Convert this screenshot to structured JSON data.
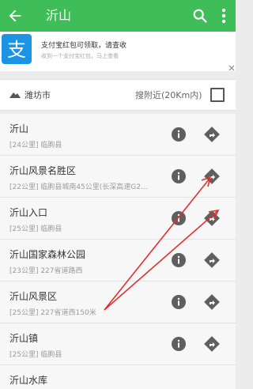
{
  "header": {
    "title": "沂山",
    "back_icon": "back-arrow-icon",
    "search_icon": "search-icon",
    "more_icon": "more-vert-icon",
    "bg_color": "#3ebd58"
  },
  "ad": {
    "title": "支付宝红包可领取，请查收",
    "subtitle": "收到一个支付宝红包，马上查看",
    "logo_icon": "alipay-logo",
    "logo_color": "#1b94e5"
  },
  "filter": {
    "city": "潍坊市",
    "nearby_label": "搜附近(20Km内)",
    "nearby_checked": false
  },
  "results": [
    {
      "name": "沂山",
      "detail": "[24公里] 临朐县"
    },
    {
      "name": "沂山风景名胜区",
      "detail": "[22公里] 临朐县城南45公里(长深高速G2..."
    },
    {
      "name": "沂山入口",
      "detail": "[25公里] 临朐县"
    },
    {
      "name": "沂山国家森林公园",
      "detail": "[23公里] 227省道路西"
    },
    {
      "name": "沂山风景区",
      "detail": "[25公里] 227省道西150米"
    },
    {
      "name": "沂山镇",
      "detail": "[25公里] 临朐县"
    },
    {
      "name": "沂山水库",
      "detail": ""
    }
  ],
  "annotation": {
    "color": "#e03030"
  }
}
